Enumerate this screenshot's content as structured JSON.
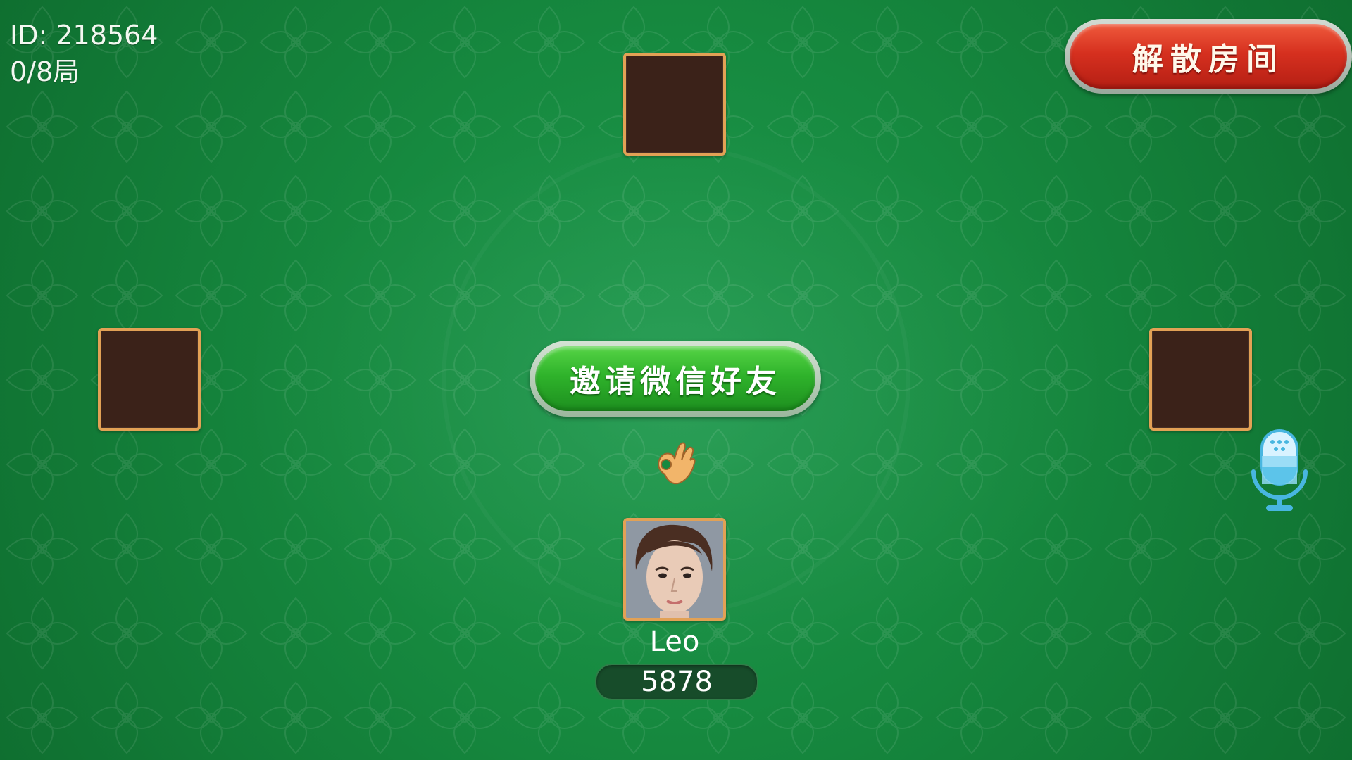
{
  "room": {
    "id_text": "ID: 218564",
    "round_text": "0/8局"
  },
  "buttons": {
    "dissolve_room": "解散房间",
    "invite_wechat_friends": "邀请微信好友"
  },
  "player": {
    "name": "Leo",
    "score": "5878",
    "ready_icon": "ok-hand-icon"
  },
  "icons": {
    "microphone": "microphone-icon"
  },
  "colors": {
    "table_green": "#16893f",
    "seat_border": "#e2a155",
    "seat_fill": "#3b2219",
    "dissolve_red": "#d6301f",
    "invite_green": "#2fb32b",
    "score_badge": "#174c2a"
  }
}
